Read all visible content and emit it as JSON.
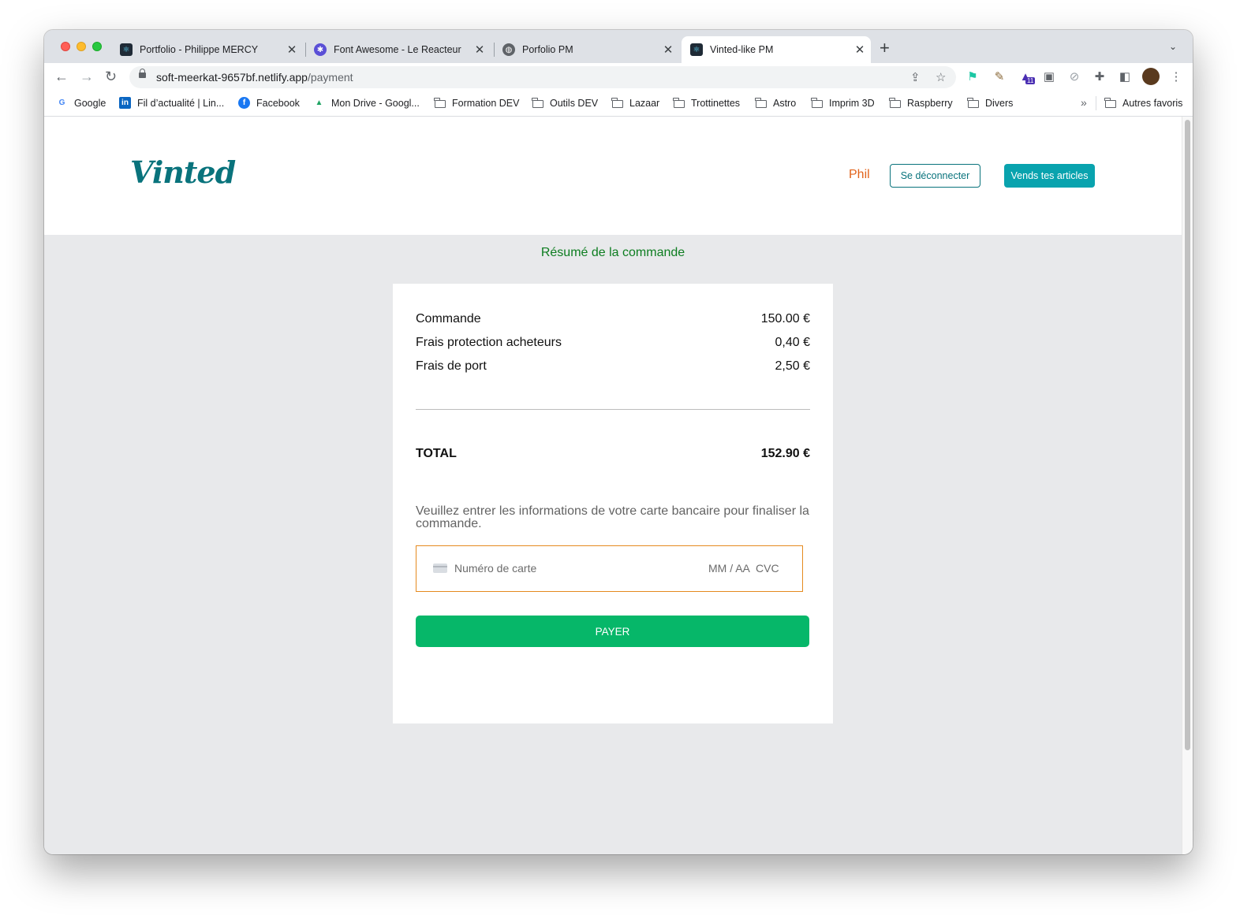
{
  "browser": {
    "tabs": [
      {
        "title": "Portfolio - Philippe MERCY",
        "icon": "react-icon"
      },
      {
        "title": "Font Awesome - Le Reacteur",
        "icon": "font-awesome-icon"
      },
      {
        "title": "Porfolio PM",
        "icon": "globe-icon"
      },
      {
        "title": "Vinted-like PM",
        "icon": "react-icon"
      }
    ],
    "active_tab": 3,
    "new_tab": "+",
    "url_host": "soft-meerkat-9657bf.netlify.app",
    "url_path": "/payment",
    "extension_badge": "11",
    "bookmarks": [
      {
        "label": "Google",
        "icon": "google-icon"
      },
      {
        "label": "Fil d’actualité | Lin...",
        "icon": "linkedin-icon"
      },
      {
        "label": "Facebook",
        "icon": "facebook-icon"
      },
      {
        "label": "Mon Drive - Googl...",
        "icon": "google-drive-icon"
      },
      {
        "label": "Formation DEV",
        "icon": "folder-icon"
      },
      {
        "label": "Outils DEV",
        "icon": "folder-icon"
      },
      {
        "label": "Lazaar",
        "icon": "folder-icon"
      },
      {
        "label": "Trottinettes",
        "icon": "folder-icon"
      },
      {
        "label": "Astro",
        "icon": "folder-icon"
      },
      {
        "label": "Imprim 3D",
        "icon": "folder-icon"
      },
      {
        "label": "Raspberry",
        "icon": "folder-icon"
      },
      {
        "label": "Divers",
        "icon": "folder-icon"
      }
    ],
    "overflow": "»",
    "other_bookmarks": "Autres favoris"
  },
  "header": {
    "logo": "Vinted",
    "username": "Phil",
    "logout_label": "Se déconnecter",
    "sell_label": "Vends tes articles"
  },
  "summary": {
    "title": "Résumé de la commande",
    "lines": [
      {
        "label": "Commande",
        "amount": "150.00 €"
      },
      {
        "label": "Frais protection acheteurs",
        "amount": "0,40 €"
      },
      {
        "label": "Frais de port",
        "amount": "2,50 €"
      }
    ],
    "total_label": "TOTAL",
    "total_amount": "152.90 €",
    "info": "Veuillez entrer les informations de votre carte bancaire pour finaliser la commande.",
    "card_placeholder": "Numéro de carte",
    "expiry_placeholder": "MM / AA",
    "cvc_placeholder": "CVC",
    "pay_label": "PAYER"
  },
  "colors": {
    "brand": "#09737c",
    "sell_button": "#09a3ae",
    "username": "#e2631b",
    "summary_title": "#0d7d20",
    "pay_button": "#06b769",
    "card_field_border": "#e58a1f"
  }
}
